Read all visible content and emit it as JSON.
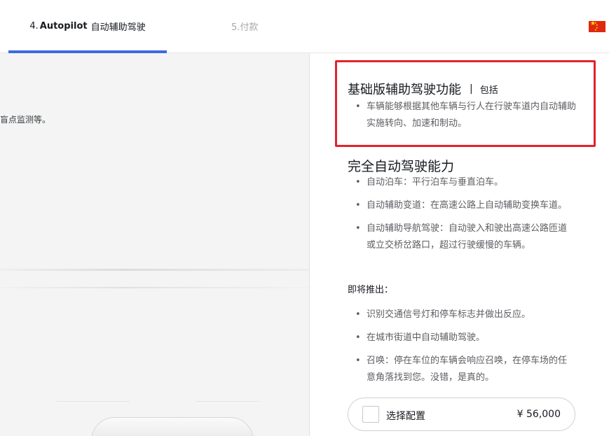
{
  "tabs": {
    "active": {
      "number": "4.",
      "name": "Autopilot",
      "cn": "自动辅助驾驶"
    },
    "next": {
      "label": "5.付款"
    }
  },
  "left_panel": {
    "partial_text": "盲点监测等。"
  },
  "basic": {
    "title": "基础版辅助驾驶功能",
    "separator": "|",
    "included": "包括",
    "items": [
      "车辆能够根据其他车辆与行人在行驶车道内自动辅助实施转向、加速和制动。"
    ]
  },
  "full": {
    "title": "完全自动驾驶能力",
    "items": [
      "自动泊车：平行泊车与垂直泊车。",
      "自动辅助变道：在高速公路上自动辅助变换车道。",
      "自动辅助导航驾驶：自动驶入和驶出高速公路匝道或立交桥岔路口，超过行驶缓慢的车辆。"
    ]
  },
  "coming_soon": {
    "label": "即将推出：",
    "items": [
      "识别交通信号灯和停车标志并做出反应。",
      "在城市街道中自动辅助驾驶。",
      "召唤：停在车位的车辆会响应召唤，在停车场的任意角落找到您。没错，是真的。"
    ]
  },
  "select": {
    "label": "选择配置",
    "price": "¥ 56,000"
  },
  "icons": {
    "flag": "china-flag-icon"
  },
  "colors": {
    "accent": "#3e6ae1",
    "highlight": "#e0242b"
  }
}
